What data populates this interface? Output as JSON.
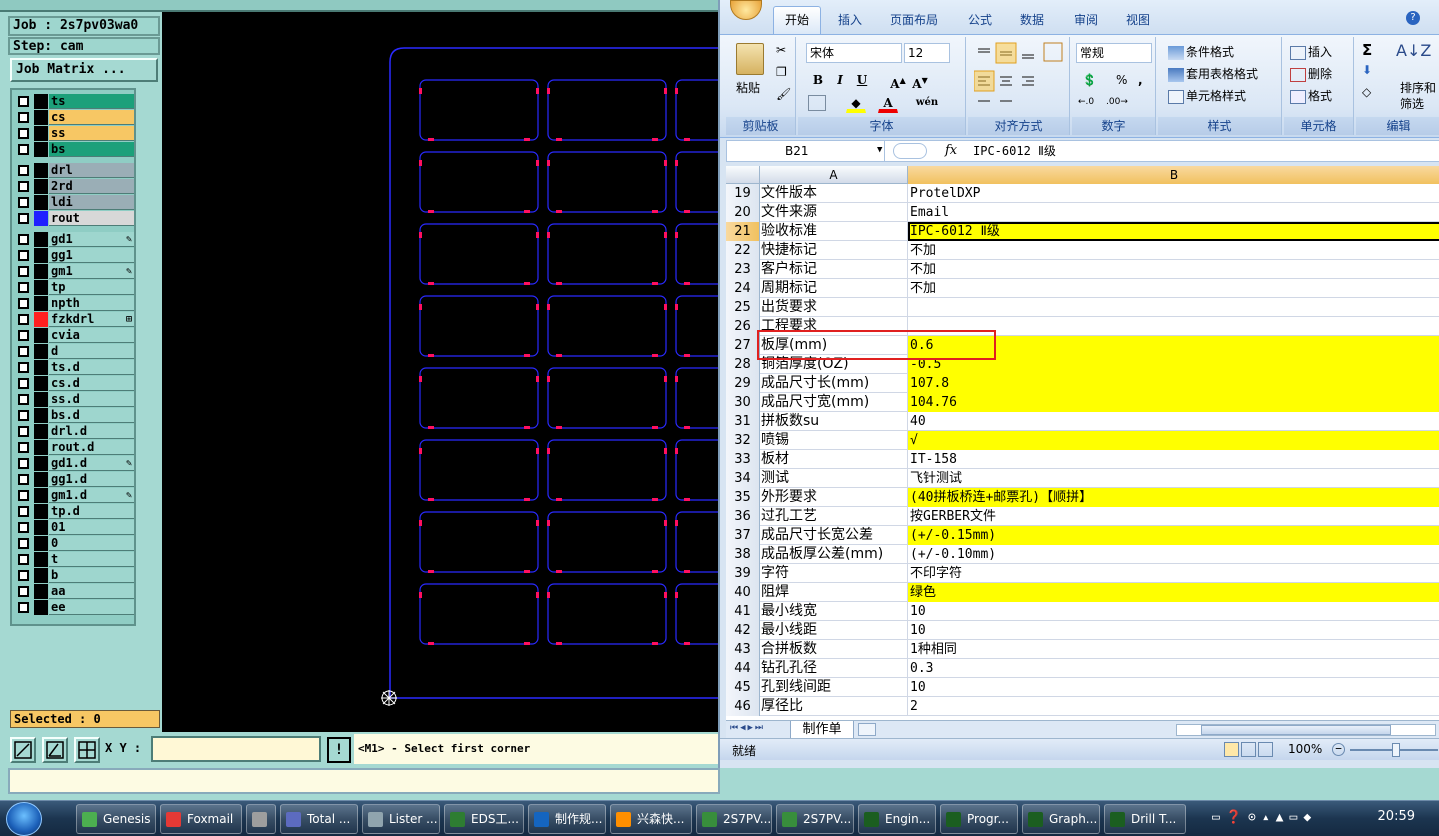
{
  "genesis": {
    "job": "Job : 2s7pv03wa0",
    "step": "Step: cam",
    "job_matrix": "Job Matrix ...",
    "selected": "Selected : 0",
    "xy_label": "X Y :",
    "xy_value": "",
    "excl": "!",
    "message": "<M1> - Select first corner",
    "layers": [
      {
        "name": "ts",
        "color": "#1ca07a",
        "swatch": "#000000",
        "flag": ""
      },
      {
        "name": "cs",
        "color": "#f7c764",
        "swatch": "#000000",
        "flag": ""
      },
      {
        "name": "ss",
        "color": "#f7c764",
        "swatch": "#000000",
        "flag": ""
      },
      {
        "name": "bs",
        "color": "#1ca07a",
        "swatch": "#000000",
        "flag": ""
      },
      {
        "name": "drl",
        "color": "#9aaeb6",
        "swatch": "#000000",
        "flag": ""
      },
      {
        "name": "2rd",
        "color": "#9aaeb6",
        "swatch": "#000000",
        "flag": ""
      },
      {
        "name": "ldi",
        "color": "#9aaeb6",
        "swatch": "#000000",
        "flag": ""
      },
      {
        "name": "rout",
        "color": "#d8d8d8",
        "swatch": "#2020ff",
        "flag": ""
      },
      {
        "name": "gd1",
        "color": "#9ed6ce",
        "swatch": "#000000",
        "flag": "✎"
      },
      {
        "name": "gg1",
        "color": "#9ed6ce",
        "swatch": "#000000",
        "flag": ""
      },
      {
        "name": "gm1",
        "color": "#9ed6ce",
        "swatch": "#000000",
        "flag": "✎"
      },
      {
        "name": "tp",
        "color": "#9ed6ce",
        "swatch": "#000000",
        "flag": ""
      },
      {
        "name": "npth",
        "color": "#9ed6ce",
        "swatch": "#000000",
        "flag": ""
      },
      {
        "name": "fzkdrl",
        "color": "#9ed6ce",
        "swatch": "#ff2020",
        "flag": "⊞"
      },
      {
        "name": "cvia",
        "color": "#9ed6ce",
        "swatch": "#000000",
        "flag": ""
      },
      {
        "name": "d",
        "color": "#9ed6ce",
        "swatch": "#000000",
        "flag": ""
      },
      {
        "name": "ts.d",
        "color": "#9ed6ce",
        "swatch": "#000000",
        "flag": ""
      },
      {
        "name": "cs.d",
        "color": "#9ed6ce",
        "swatch": "#000000",
        "flag": ""
      },
      {
        "name": "ss.d",
        "color": "#9ed6ce",
        "swatch": "#000000",
        "flag": ""
      },
      {
        "name": "bs.d",
        "color": "#9ed6ce",
        "swatch": "#000000",
        "flag": ""
      },
      {
        "name": "drl.d",
        "color": "#9ed6ce",
        "swatch": "#000000",
        "flag": ""
      },
      {
        "name": "rout.d",
        "color": "#9ed6ce",
        "swatch": "#000000",
        "flag": ""
      },
      {
        "name": "gd1.d",
        "color": "#9ed6ce",
        "swatch": "#000000",
        "flag": "✎"
      },
      {
        "name": "gg1.d",
        "color": "#9ed6ce",
        "swatch": "#000000",
        "flag": ""
      },
      {
        "name": "gm1.d",
        "color": "#9ed6ce",
        "swatch": "#000000",
        "flag": "✎"
      },
      {
        "name": "tp.d",
        "color": "#9ed6ce",
        "swatch": "#000000",
        "flag": ""
      },
      {
        "name": "01",
        "color": "#9ed6ce",
        "swatch": "#000000",
        "flag": ""
      },
      {
        "name": "0",
        "color": "#9ed6ce",
        "swatch": "#000000",
        "flag": ""
      },
      {
        "name": "t",
        "color": "#9ed6ce",
        "swatch": "#000000",
        "flag": ""
      },
      {
        "name": "b",
        "color": "#9ed6ce",
        "swatch": "#000000",
        "flag": ""
      },
      {
        "name": "aa",
        "color": "#9ed6ce",
        "swatch": "#000000",
        "flag": ""
      },
      {
        "name": "ee",
        "color": "#9ed6ce",
        "swatch": "#000000",
        "flag": ""
      }
    ],
    "canvas": {
      "bg": "#000000",
      "outline": "#2a2aff",
      "marker": "#ff1060",
      "board_rows": 8,
      "board_cols": 3
    }
  },
  "excel": {
    "tabs": [
      "开始",
      "插入",
      "页面布局",
      "公式",
      "数据",
      "审阅",
      "视图"
    ],
    "clipboard": {
      "paste": "粘贴",
      "label": "剪贴板"
    },
    "font": {
      "name": "宋体",
      "size": "12",
      "label": "字体",
      "bold": "B",
      "italic": "I",
      "underline": "U",
      "font_color": "A",
      "phonetic": "wén"
    },
    "alignment": {
      "label": "对齐方式"
    },
    "number": {
      "format": "常规",
      "percent": "%",
      "comma": ",",
      "label": "数字"
    },
    "styles": {
      "conditional": "条件格式",
      "table": "套用表格格式",
      "cell_style": "单元格样式",
      "label": "样式"
    },
    "cells": {
      "insert": "插入",
      "delete": "删除",
      "format": "格式",
      "label": "单元格"
    },
    "editing": {
      "sigma": "Σ",
      "sort": "排序和",
      "filter": "筛选",
      "label": "编辑"
    },
    "name_box": "B21",
    "fx": "fx",
    "formula": "IPC-6012 Ⅱ级",
    "col_headers": [
      "A",
      "B"
    ],
    "rows": [
      {
        "n": "19",
        "a": "文件版本",
        "b": "ProtelDXP",
        "hl": false
      },
      {
        "n": "20",
        "a": "文件来源",
        "b": "Email",
        "hl": false
      },
      {
        "n": "21",
        "a": "验收标准",
        "b": "IPC-6012 Ⅱ级",
        "hl": true
      },
      {
        "n": "22",
        "a": "快捷标记",
        "b": "不加",
        "hl": false
      },
      {
        "n": "23",
        "a": "客户标记",
        "b": "不加",
        "hl": false
      },
      {
        "n": "24",
        "a": "周期标记",
        "b": "不加",
        "hl": false
      },
      {
        "n": "25",
        "a": "出货要求",
        "b": "",
        "hl": false
      },
      {
        "n": "26",
        "a": "工程要求",
        "b": "",
        "hl": false
      },
      {
        "n": "27",
        "a": "板厚(mm)",
        "b": "0.6",
        "hl": true
      },
      {
        "n": "28",
        "a": "铜箔厚度(OZ)",
        "b": "-0.5",
        "hl": true
      },
      {
        "n": "29",
        "a": "成品尺寸长(mm)",
        "b": "107.8",
        "hl": true
      },
      {
        "n": "30",
        "a": "成品尺寸宽(mm)",
        "b": "104.76",
        "hl": true
      },
      {
        "n": "31",
        "a": "拼板数su",
        "b": "40",
        "hl": false
      },
      {
        "n": "32",
        "a": "喷锡",
        "b": "√",
        "hl": true
      },
      {
        "n": "33",
        "a": "板材",
        "b": "IT-158",
        "hl": false
      },
      {
        "n": "34",
        "a": "测试",
        "b": "飞针测试",
        "hl": false
      },
      {
        "n": "35",
        "a": "外形要求",
        "b": "(40拼板桥连+邮票孔)【顺拼】",
        "hl": true
      },
      {
        "n": "36",
        "a": "过孔工艺",
        "b": "按GERBER文件",
        "hl": false
      },
      {
        "n": "37",
        "a": "成品尺寸长宽公差",
        "b": "(+/-0.15mm)",
        "hl": true
      },
      {
        "n": "38",
        "a": "成品板厚公差(mm)",
        "b": "(+/-0.10mm)",
        "hl": false
      },
      {
        "n": "39",
        "a": "字符",
        "b": "不印字符",
        "hl": false
      },
      {
        "n": "40",
        "a": "阻焊",
        "b": "绿色",
        "hl": true
      },
      {
        "n": "41",
        "a": "最小线宽",
        "b": "10",
        "hl": false
      },
      {
        "n": "42",
        "a": "最小线距",
        "b": "10",
        "hl": false
      },
      {
        "n": "43",
        "a": "合拼板数",
        "b": "1种相同",
        "hl": false
      },
      {
        "n": "44",
        "a": "钻孔孔径",
        "b": "0.3",
        "hl": false
      },
      {
        "n": "45",
        "a": "孔到线间距",
        "b": "10",
        "hl": false
      },
      {
        "n": "46",
        "a": "厚径比",
        "b": "2",
        "hl": false
      }
    ],
    "sheet_tab": "制作单",
    "status": "就绪",
    "zoom": "100%"
  },
  "taskbar": {
    "items": [
      {
        "label": "Genesis",
        "color": "#4caf50"
      },
      {
        "label": "Foxmail",
        "color": "#e53935"
      },
      {
        "label": "",
        "color": "#9e9e9e"
      },
      {
        "label": "Total ...",
        "color": "#5c6bc0"
      },
      {
        "label": "Lister ...",
        "color": "#90a4ae"
      },
      {
        "label": "EDS工...",
        "color": "#2e7d32"
      },
      {
        "label": "制作规...",
        "color": "#1565c0"
      },
      {
        "label": "兴森快...",
        "color": "#ff8f00"
      },
      {
        "label": "2S7PV...",
        "color": "#388e3c"
      },
      {
        "label": "2S7PV...",
        "color": "#388e3c"
      },
      {
        "label": "Engin...",
        "color": "#1b5e20"
      },
      {
        "label": "Progr...",
        "color": "#1b5e20"
      },
      {
        "label": "Graph...",
        "color": "#1b5e20"
      },
      {
        "label": "Drill T...",
        "color": "#1b5e20"
      }
    ],
    "clock": "20:59"
  }
}
